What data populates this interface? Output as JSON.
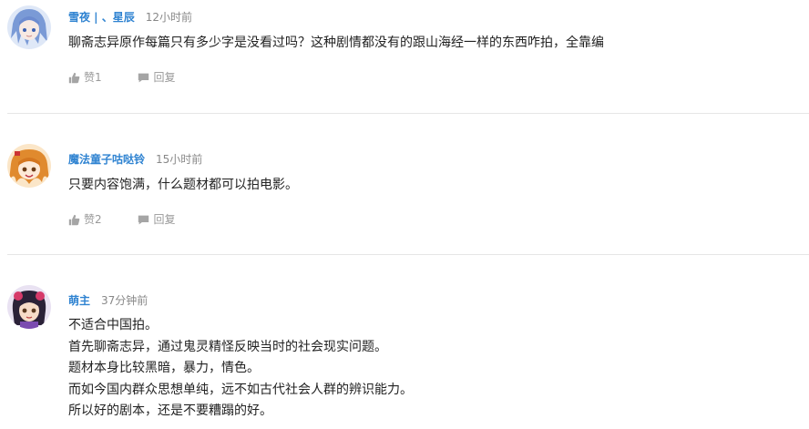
{
  "comments": [
    {
      "username": "雪夜 | 、星辰",
      "timestamp": "12小时前",
      "lines": [
        "聊斋志异原作每篇只有多少字是没看过吗？这种剧情都没有的跟山海经一样的东西咋拍，全靠编"
      ],
      "like_label": "赞1",
      "reply_label": "回复"
    },
    {
      "username": "魔法童子咕哒铃",
      "timestamp": "15小时前",
      "lines": [
        "只要内容饱满，什么题材都可以拍电影。"
      ],
      "like_label": "赞2",
      "reply_label": "回复"
    },
    {
      "username": "萌主",
      "timestamp": "37分钟前",
      "lines": [
        "不适合中国拍。",
        "首先聊斋志异，通过鬼灵精怪反映当时的社会现实问题。",
        "题材本身比较黑暗，暴力，情色。",
        "而如今国内群众思想单纯，远不如古代社会人群的辨识能力。",
        "所以好的剧本，还是不要糟蹋的好。"
      ]
    }
  ],
  "colors": {
    "username": "#2f83d1",
    "timestamp": "#888888",
    "action": "#999999",
    "divider": "#e6e6e6"
  },
  "icons": {
    "like": "thumbs-up-icon",
    "reply": "speech-bubble-icon"
  }
}
